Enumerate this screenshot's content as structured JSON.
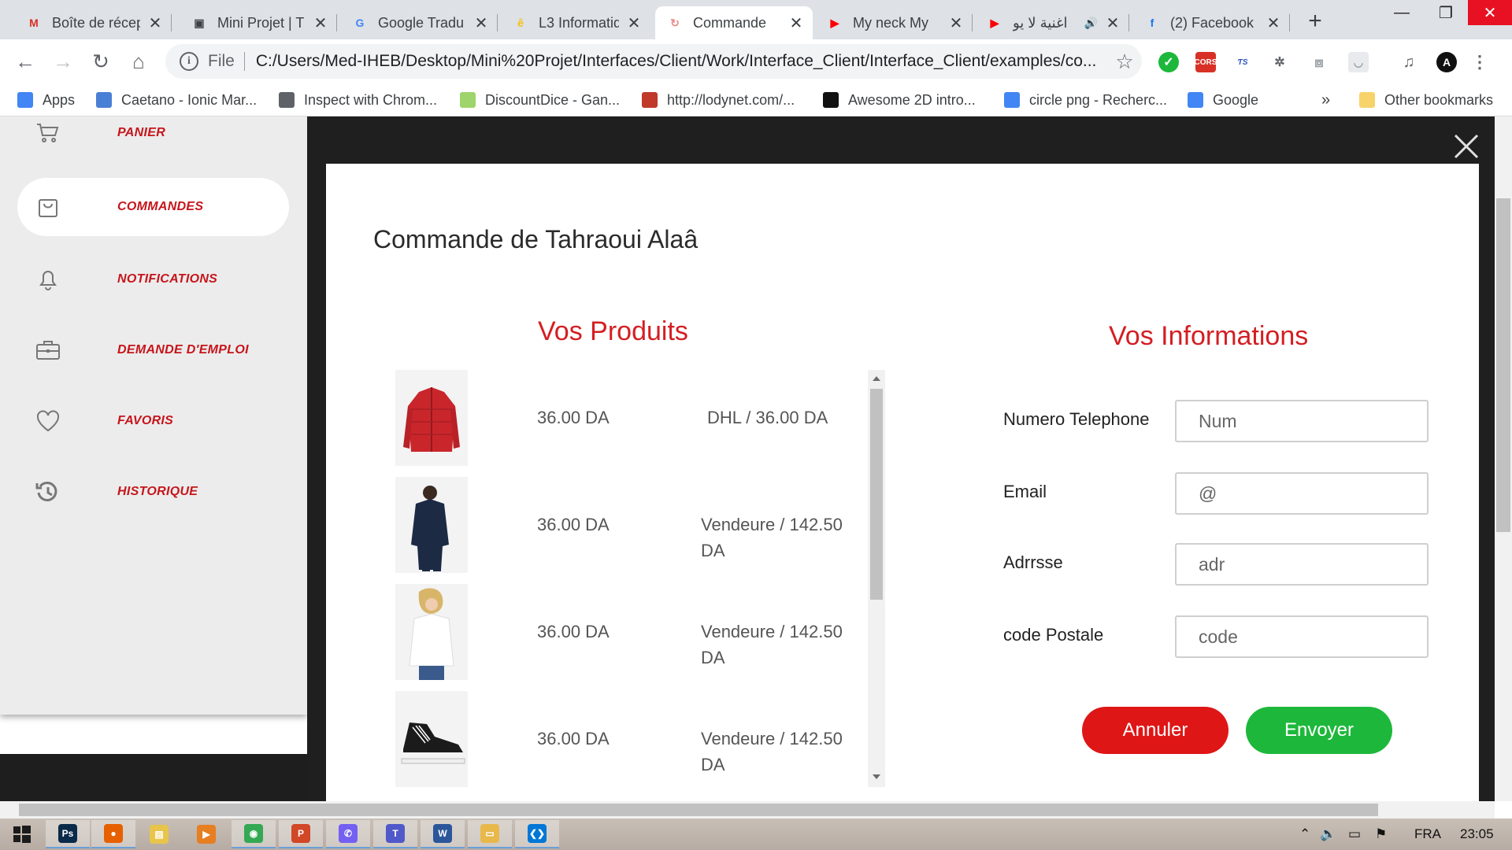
{
  "browser": {
    "tabs": [
      {
        "label": "Boîte de récep",
        "icon": "gmail-icon",
        "icon_glyph": "M",
        "icon_color": "#d93025",
        "active": false
      },
      {
        "label": "Mini Projet | T",
        "icon": "trello-icon",
        "icon_glyph": "▣",
        "icon_color": "#3c4043",
        "active": false
      },
      {
        "label": "Google Tradu",
        "icon": "google-translate-icon",
        "icon_glyph": "G",
        "icon_color": "#4285f4",
        "active": false
      },
      {
        "label": "L3 Informatiq",
        "icon": "ecampus-icon",
        "icon_glyph": "ê",
        "icon_color": "#f4c20d",
        "active": false
      },
      {
        "label": "Commande",
        "icon": "page-loading-icon",
        "icon_glyph": "↻",
        "icon_color": "#ea8a8a",
        "active": true
      },
      {
        "label": "My neck My",
        "icon": "youtube-icon",
        "icon_glyph": "▶",
        "icon_color": "#ff0000",
        "active": false
      },
      {
        "label": "اغنية لا يو",
        "icon": "youtube-icon",
        "icon_glyph": "▶",
        "icon_color": "#ff0000",
        "active": false,
        "audio": "🔊"
      },
      {
        "label": "(2) Facebook",
        "icon": "facebook-icon",
        "icon_glyph": "f",
        "icon_color": "#1877f2",
        "active": false
      }
    ],
    "new_tab": "+",
    "address": {
      "scheme": "File",
      "url": "C:/Users/Med-IHEB/Desktop/Mini%20Projet/Interfaces/Client/Work/Interface_Client/Interface_Client/examples/co..."
    },
    "bookmarks": [
      {
        "label": "Apps",
        "icon": "apps-grid-icon",
        "icon_color": "#4285f4"
      },
      {
        "label": "Caetano - Ionic Mar...",
        "icon": "caetano-icon",
        "icon_color": "#4a7fd6"
      },
      {
        "label": "Inspect with Chrom...",
        "icon": "chrome-devtools-icon",
        "icon_color": "#5f6368"
      },
      {
        "label": "DiscountDice - Gan...",
        "icon": "discountdice-icon",
        "icon_color": "#9fd36c"
      },
      {
        "label": "http://lodynet.com/...",
        "icon": "lodynet-icon",
        "icon_color": "#c0392b"
      },
      {
        "label": "Awesome 2D intro...",
        "icon": "flaticon-icon",
        "icon_color": "#111111"
      },
      {
        "label": "circle png - Recherc...",
        "icon": "google-icon",
        "icon_color": "#4285f4"
      },
      {
        "label": "Google",
        "icon": "google-icon",
        "icon_color": "#4285f4"
      }
    ],
    "bookmarks_overflow": "»",
    "other_bookmarks": "Other bookmarks"
  },
  "sidebar": {
    "items": [
      {
        "label": "PANIER",
        "icon": "cart-icon",
        "active": false
      },
      {
        "label": "COMMANDES",
        "icon": "shopping-bag-icon",
        "active": true
      },
      {
        "label": "NOTIFICATIONS",
        "icon": "bell-icon",
        "active": false
      },
      {
        "label": "DEMANDE D'EMPLOI",
        "icon": "briefcase-icon",
        "active": false
      },
      {
        "label": "FAVORIS",
        "icon": "heart-icon",
        "active": false
      },
      {
        "label": "HISTORIQUE",
        "icon": "history-icon",
        "active": false
      }
    ]
  },
  "modal": {
    "title": "Commande de Tahraoui Alaâ",
    "products_title": "Vos Produits",
    "info_title": "Vos Informations",
    "products": [
      {
        "image": "red-jacket",
        "price": "36.00 DA",
        "shipping": "DHL / 36.00 DA"
      },
      {
        "image": "navy-jacket-man",
        "price": "36.00 DA",
        "shipping": "Vendeure / 142.50 DA"
      },
      {
        "image": "white-shirt-woman",
        "price": "36.00 DA",
        "shipping": "Vendeure / 142.50 DA"
      },
      {
        "image": "black-sneaker",
        "price": "36.00 DA",
        "shipping": "Vendeure / 142.50 DA"
      }
    ],
    "form": {
      "phone": {
        "label": "Numero Telephone",
        "placeholder": "Num"
      },
      "email": {
        "label": "Email",
        "placeholder": "@"
      },
      "address": {
        "label": "Adrrsse",
        "placeholder": "adr"
      },
      "postal": {
        "label": "code Postale",
        "placeholder": "code"
      }
    },
    "cancel_label": "Annuler",
    "submit_label": "Envoyer",
    "colors": {
      "accent": "#d41e22",
      "cancel": "#df1616",
      "submit": "#1db83b"
    }
  },
  "taskbar": {
    "apps": [
      {
        "name": "photoshop-icon",
        "glyph": "Ps",
        "color": "#0a2a4a"
      },
      {
        "name": "firefox-icon",
        "glyph": "●",
        "color": "#e66000"
      },
      {
        "name": "notes-icon",
        "glyph": "▤",
        "color": "#e8c54a"
      },
      {
        "name": "media-player-icon",
        "glyph": "▶",
        "color": "#e67e22"
      },
      {
        "name": "chrome-icon",
        "glyph": "◉",
        "color": "#34a853"
      },
      {
        "name": "powerpoint-icon",
        "glyph": "P",
        "color": "#d24726"
      },
      {
        "name": "viber-icon",
        "glyph": "✆",
        "color": "#7360f2"
      },
      {
        "name": "teams-icon",
        "glyph": "T",
        "color": "#5059c9"
      },
      {
        "name": "word-icon",
        "glyph": "W",
        "color": "#2b579a"
      },
      {
        "name": "file-explorer-icon",
        "glyph": "▭",
        "color": "#e8b84a"
      },
      {
        "name": "vscode-icon",
        "glyph": "❮❯",
        "color": "#0078d7"
      }
    ],
    "language": "FRA",
    "time": "23:05"
  }
}
